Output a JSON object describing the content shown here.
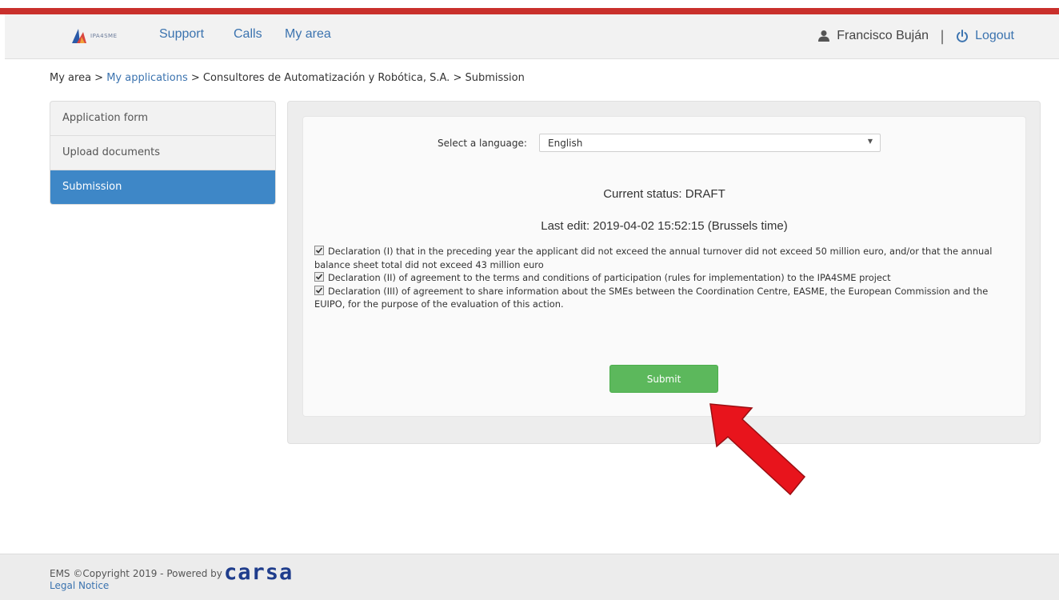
{
  "header": {
    "logo_text": "IPA4SME",
    "nav": [
      "Support",
      "Calls",
      "My area"
    ],
    "user_name": "Francisco Buján",
    "divider": "|",
    "logout_label": "Logout"
  },
  "breadcrumb": {
    "root": "My area",
    "sep1": " > ",
    "link": "My applications",
    "sep2": " > ",
    "company": "Consultores de Automatización y Robótica, S.A.",
    "sep3": " > ",
    "current": "Submission"
  },
  "sidebar": {
    "items": [
      {
        "label": "Application form",
        "active": false
      },
      {
        "label": "Upload documents",
        "active": false
      },
      {
        "label": "Submission",
        "active": true
      }
    ]
  },
  "form": {
    "language_label": "Select a language:",
    "language_value": "English",
    "status_label": "Current status:",
    "status_value": "DRAFT",
    "last_edit": "Last edit: 2019-04-02 15:52:15 (Brussels time)",
    "declarations": [
      {
        "checked": true,
        "text": "Declaration (I) that in the preceding year the applicant did not exceed the annual turnover did not exceed 50 million euro, and/or that the annual balance sheet total did not exceed 43 million euro"
      },
      {
        "checked": true,
        "text": "Declaration (II) of agreement to the terms and conditions of participation (rules for implementation) to the IPA4SME project"
      },
      {
        "checked": true,
        "text": "Declaration (III) of agreement to share information about the SMEs between the Coordination Centre, EASME, the European Commission and the EUIPO, for the purpose of the evaluation of this action."
      }
    ],
    "submit_label": "Submit"
  },
  "footer": {
    "copyright": "EMS ©Copyright 2019 - Powered by",
    "brand": "carsa",
    "legal_notice": "Legal Notice"
  },
  "colors": {
    "accent_red": "#c9302c",
    "link_blue": "#3b73af",
    "active_blue": "#3e87c7",
    "submit_green": "#5cb85c",
    "annotation_red": "#e8141c",
    "carsa_blue": "#1f3d8c"
  },
  "icons": {
    "user": "user-icon",
    "logout": "power-icon",
    "dropdown": "chevron-down-icon",
    "checkbox": "checkmark-icon"
  }
}
